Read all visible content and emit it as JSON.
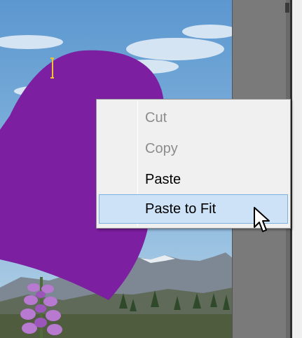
{
  "context_menu": {
    "items": [
      {
        "label": "Cut",
        "enabled": false,
        "highlighted": false
      },
      {
        "label": "Copy",
        "enabled": false,
        "highlighted": false
      },
      {
        "label": "Paste",
        "enabled": true,
        "highlighted": false
      },
      {
        "label": "Paste to Fit",
        "enabled": true,
        "highlighted": true
      }
    ]
  },
  "colors": {
    "shape_fill": "#7c1fa1",
    "sky": "#6fa6d6",
    "menu_background": "#f0f0f0",
    "menu_highlight": "#cde2f6",
    "text_cursor": "#f2c230"
  },
  "icons": {
    "text_cursor": "text-insertion-cursor-icon",
    "pointer": "mouse-pointer-icon"
  }
}
